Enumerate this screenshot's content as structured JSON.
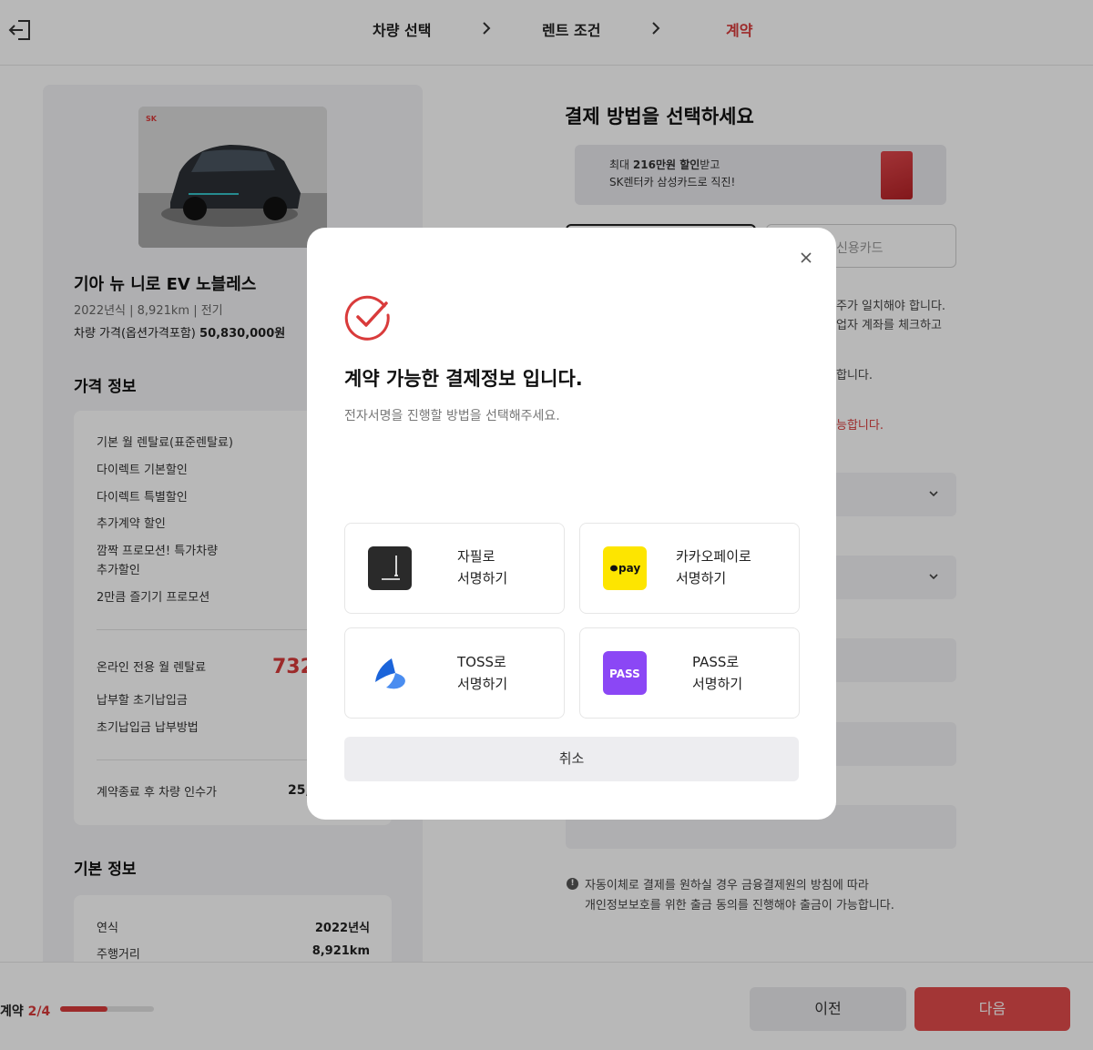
{
  "header": {
    "steps": [
      "차량 선택",
      "렌트 조건",
      "계약"
    ],
    "active_step": "계약"
  },
  "car": {
    "title": "기아 뉴 니로 EV 노블레스",
    "meta": "2022년식 | 8,921km | 전기",
    "price_label": "차량 가격(옵션가격포함)",
    "price_value": "50,830,000원"
  },
  "price_info": {
    "section_title": "가격 정보",
    "items": [
      "기본 월 렌탈료(표준렌탈료)",
      "다이렉트 기본할인",
      "다이렉트 특별할인",
      "추가계약 할인",
      "깜짝 프로모션! 특가차량",
      "추가할인",
      "2만큼 즐기기 프로모션"
    ],
    "online_label": "온라인 전용 월 렌탈료",
    "online_value": "732",
    "initial_payment": "납부할 초기납입금",
    "initial_method": "초기납입금 납부방법",
    "buyout_label": "계약종료 후 차량 인수가",
    "buyout_value": "25,"
  },
  "basic_info": {
    "section_title": "기본 정보",
    "year_label": "연식",
    "year_value": "2022년식",
    "mileage_label": "주행거리",
    "mileage_value": "8,921km"
  },
  "payment": {
    "title": "결제 방법을 선택하세요",
    "banner_line1_pre": "최대 ",
    "banner_line1_bold": "216만원 할인",
    "banner_line1_post": "받고",
    "banner_line2": "SK렌터카 삼성카드로 직진!",
    "tab_credit": "신용카드",
    "text1": "주가 일치해야 합니다.",
    "text2": "업자 계좌를 체크하고",
    "text3": "합니다.",
    "text4": "능합니다.",
    "notice_line1": "자동이체로 결제를 원하실 경우 금융결제원의 방침에 따라",
    "notice_line2": "개인정보보호를 위한 출금 동의를 진행해야 출금이 가능합니다."
  },
  "footer": {
    "progress_label": "계약",
    "progress_value": "2/4",
    "progress_fraction": 0.5,
    "prev_label": "이전",
    "next_label": "다음"
  },
  "modal": {
    "title": "계약 가능한 결제정보 입니다.",
    "subtitle": "전자서명을 진행할 방법을 선택해주세요.",
    "options": [
      {
        "line1": "자필로",
        "line2": "서명하기"
      },
      {
        "line1": "카카오페이로",
        "line2": "서명하기"
      },
      {
        "line1": "TOSS로",
        "line2": "서명하기"
      },
      {
        "line1": "PASS로",
        "line2": "서명하기"
      }
    ],
    "kakao_icon_text": "pay",
    "pass_icon_text": "PASS",
    "cancel_label": "취소"
  },
  "colors": {
    "accent": "#d93b3b",
    "kakao": "#fde500",
    "pass": "#8b47f5",
    "toss": "#1b64da"
  }
}
